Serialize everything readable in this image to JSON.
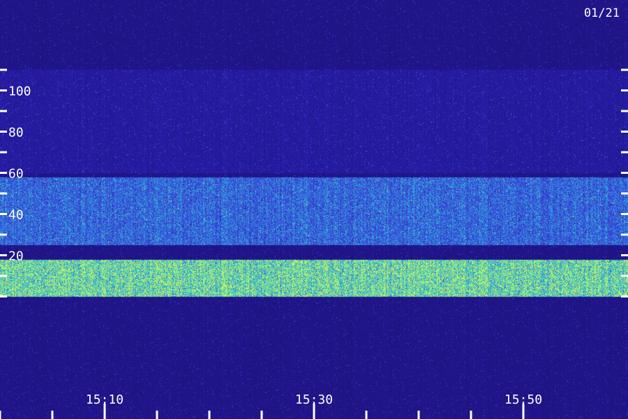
{
  "date_label": "01/21",
  "chart_data": {
    "type": "heatmap",
    "title": "",
    "xlabel": "",
    "ylabel": "",
    "ylim": [
      0,
      120
    ],
    "xlim": [
      "14:55",
      "15:55"
    ],
    "y_tick_labels": [
      "100",
      "80",
      "60",
      "40",
      "20"
    ],
    "y_major_ticks": [
      100,
      80,
      60,
      40,
      20
    ],
    "y_minor_ticks": [
      110,
      90,
      70,
      50,
      30,
      10,
      0
    ],
    "x_tick_labels": [
      "15:10",
      "15:30",
      "15:50"
    ],
    "x_major_ticks": [
      "15:10",
      "15:30",
      "15:50"
    ],
    "x_minor_ticks": [
      "15:00",
      "15:05",
      "15:15",
      "15:20",
      "15:25",
      "15:35",
      "15:40",
      "15:45"
    ],
    "intensity_bands": [
      {
        "y_from": 60,
        "y_to": 110,
        "level": 0.15
      },
      {
        "y_from": 25,
        "y_to": 58,
        "level": 0.45
      },
      {
        "y_from": 0,
        "y_to": 18,
        "level": 0.85
      }
    ],
    "colormap": [
      "#1a0f6e",
      "#2a1fb0",
      "#3f4fe0",
      "#2aa0e0",
      "#38e0c0",
      "#c8f060"
    ]
  }
}
